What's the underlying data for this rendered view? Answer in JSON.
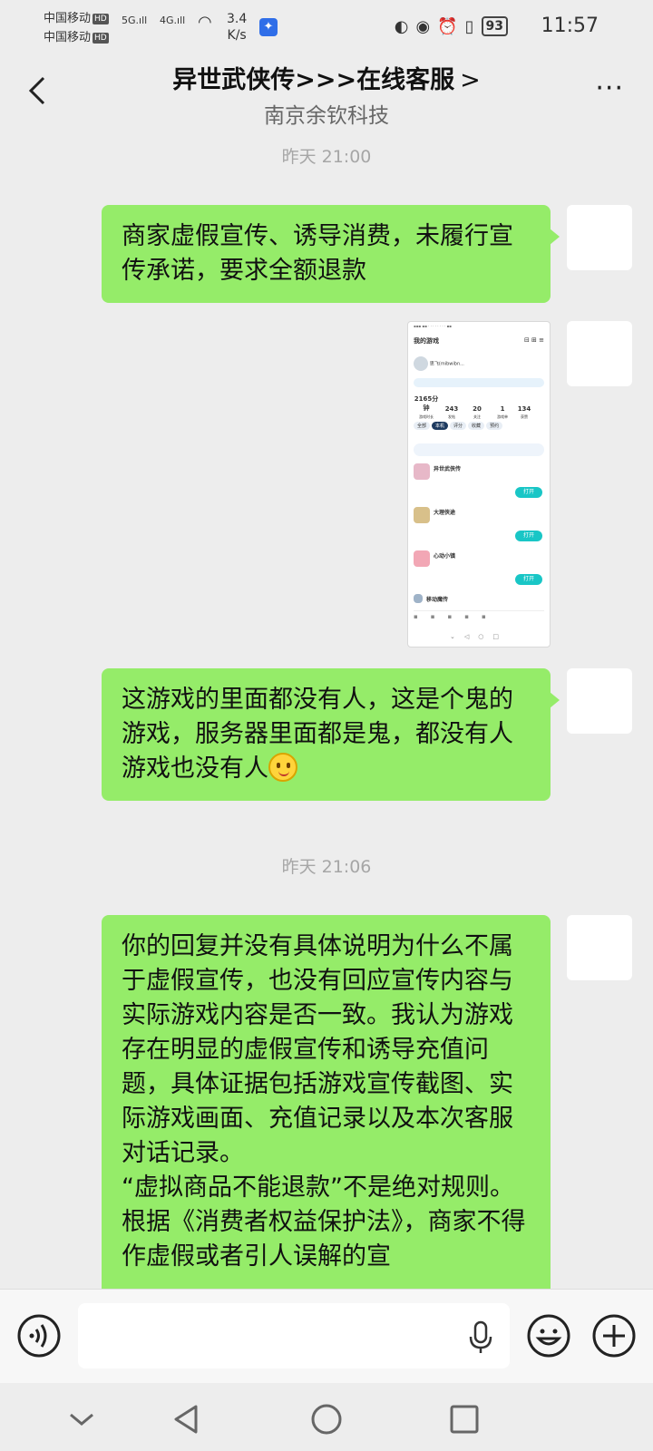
{
  "status_bar": {
    "carrier_1": "中国移动",
    "carrier_2": "中国移动",
    "hd": "HD",
    "net_1": "5G",
    "net_2": "4G",
    "speed_value": "3.4",
    "speed_unit": "K/s",
    "battery": "93",
    "time": "11:57"
  },
  "header": {
    "title": "异世武侠传>>>在线客服",
    "title_chevron": ">",
    "subtitle": "南京余钦科技",
    "more": "···"
  },
  "messages": {
    "ts1": "昨天 21:00",
    "msg1": "商家虚假宣传、诱导消费，未履行宣传承诺，要求全额退款",
    "msg2": "这游戏的里面都没有人，这是个鬼的游戏，服务器里面都是鬼，都没有人游戏也没有人",
    "ts2": "昨天 21:06",
    "msg3_p1": "你的回复并没有具体说明为什么不属于虚假宣传，也没有回应宣传内容与实际游戏内容是否一致。我认为游戏存在明显的虚假宣传和诱导充值问题，具体证据包括游戏宣传截图、实际游戏画面、充值记录以及本次客服对话记录。",
    "msg3_p2": "“虚拟商品不能退款”不是绝对规则。根据《消费者权益保护法》，商家不得作虚假或者引人误解的宣"
  },
  "screenshot": {
    "title": "我的游戏",
    "user": "思飞(mibwibn...",
    "stats": [
      {
        "value": "2165分钟",
        "label": "游戏时长"
      },
      {
        "value": "243",
        "label": "发帖"
      },
      {
        "value": "20",
        "label": "关注"
      },
      {
        "value": "1",
        "label": "游戏单"
      },
      {
        "value": "134",
        "label": "获赞"
      }
    ],
    "tabs": [
      "全部",
      "本机",
      "评分",
      "收藏",
      "预约"
    ],
    "games": [
      {
        "name": "异世武侠传",
        "action": "打开"
      },
      {
        "name": "大理侠途",
        "action": "打开"
      },
      {
        "name": "心动小镇",
        "action": "打开"
      },
      {
        "name": "移动魔传",
        "action": ""
      }
    ]
  },
  "icons": {
    "back": "chevron-left-icon",
    "voice": "voice-icon",
    "mic": "microphone-icon",
    "emoji": "emoji-icon",
    "plus": "plus-icon"
  }
}
